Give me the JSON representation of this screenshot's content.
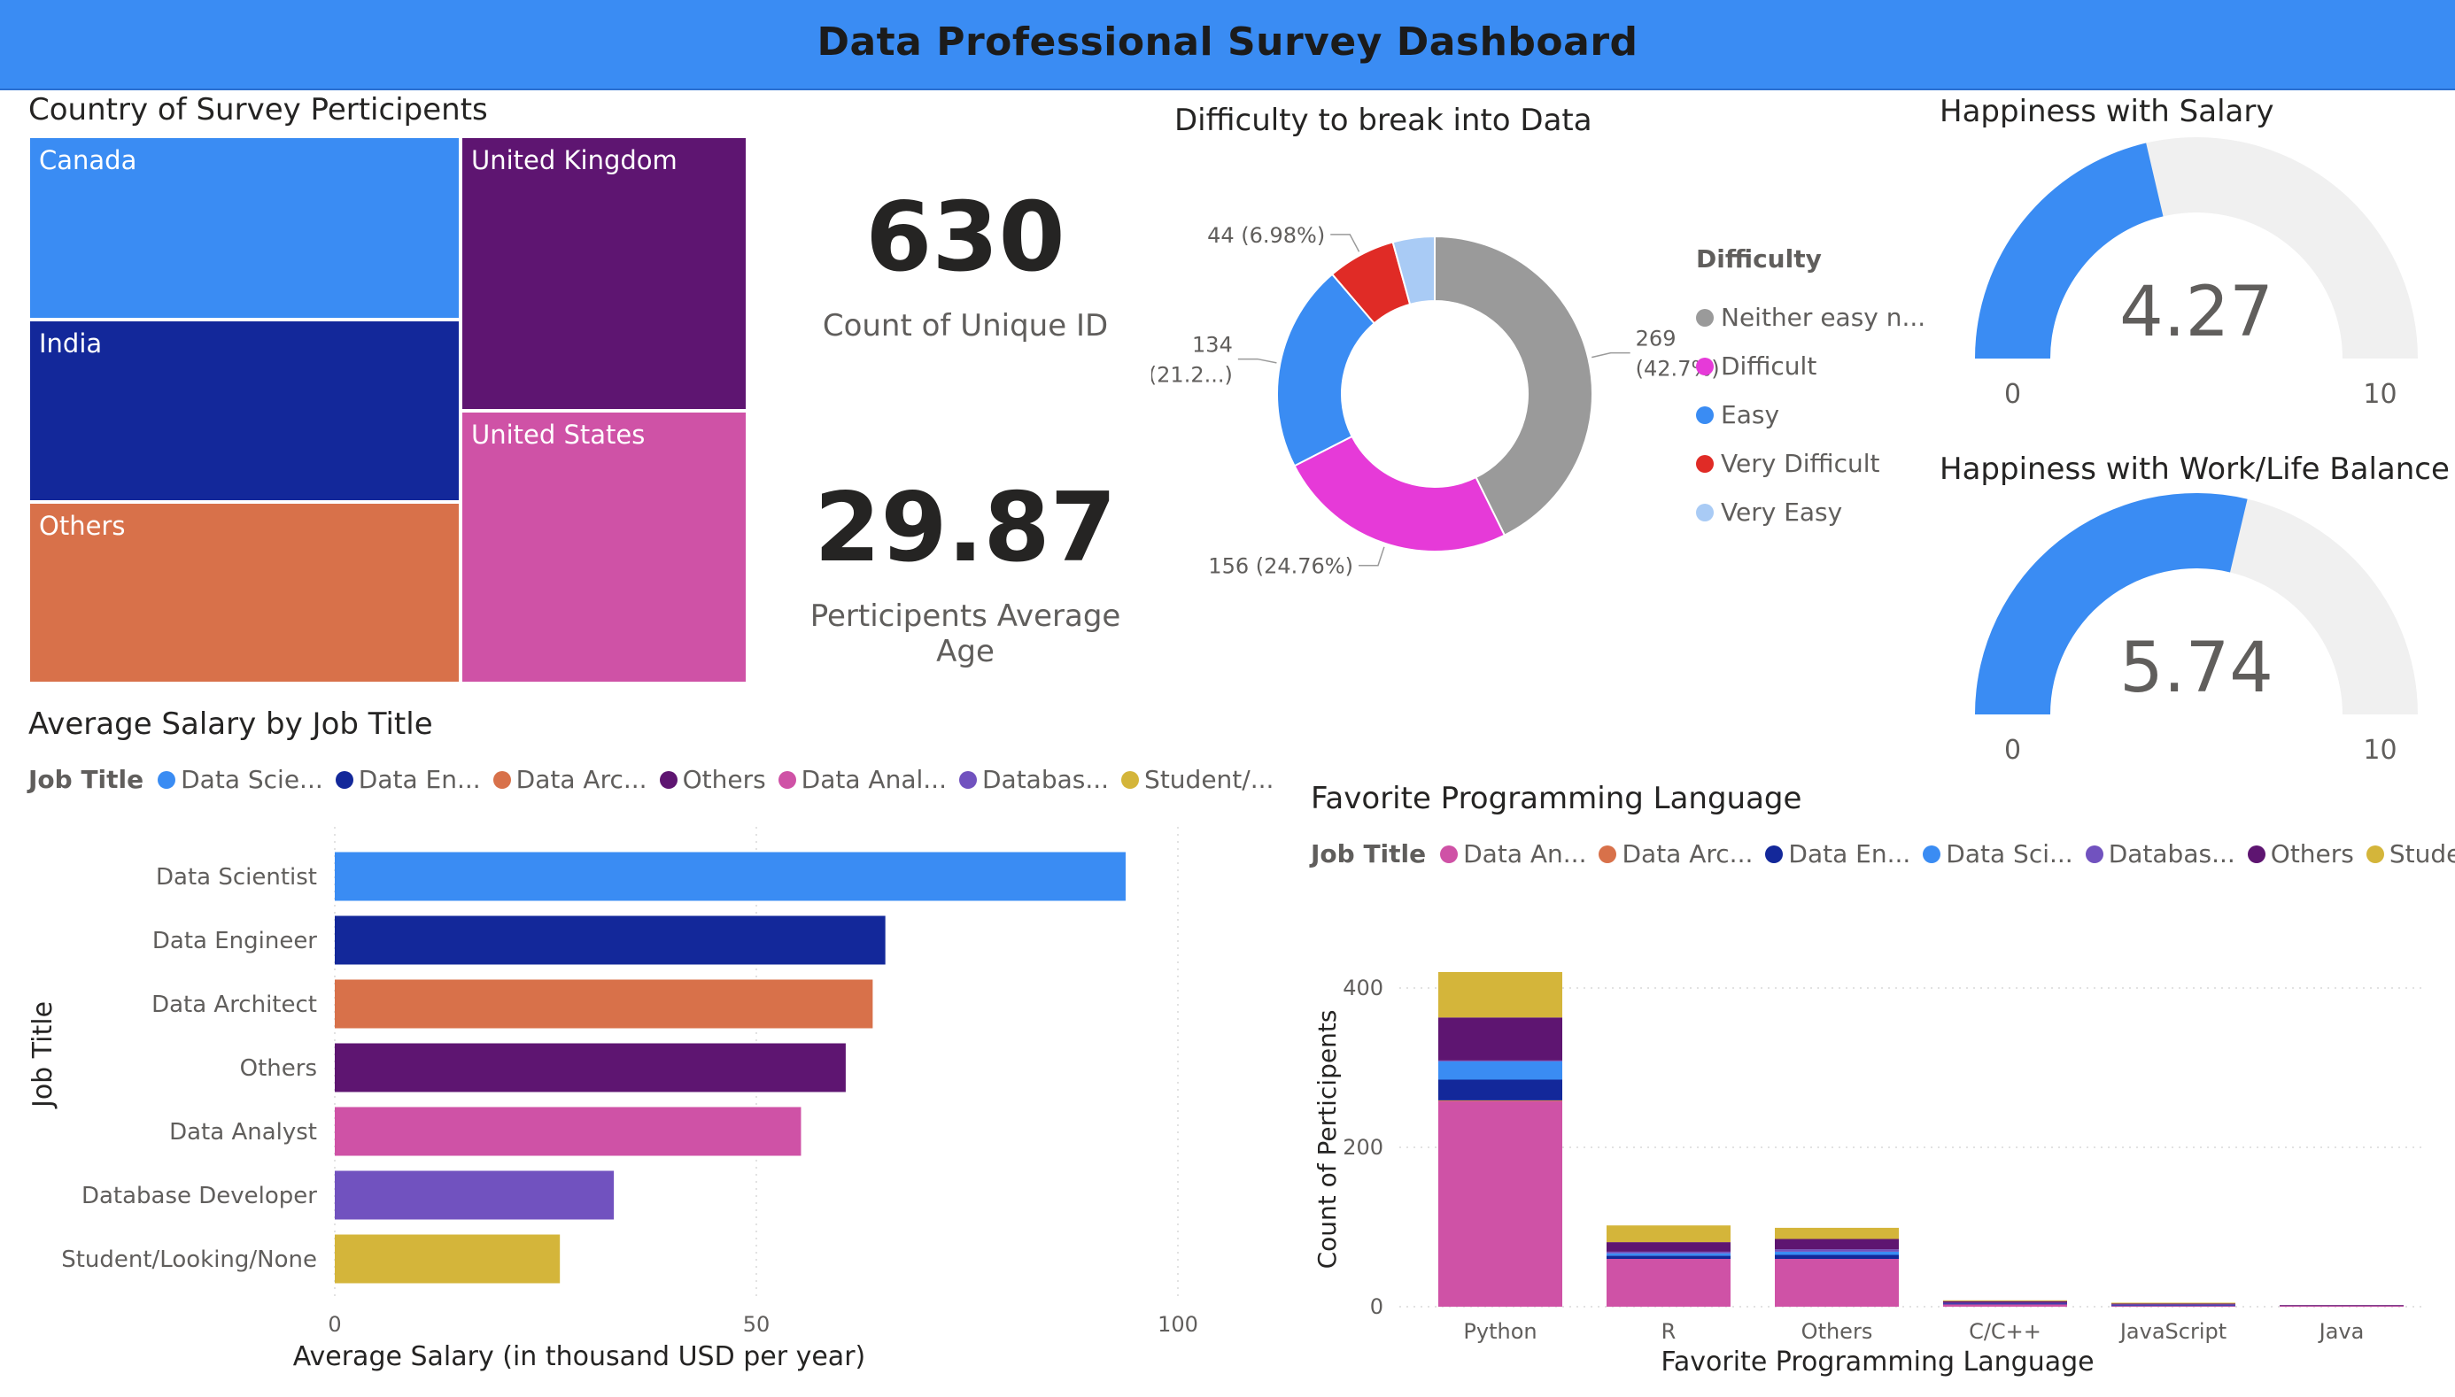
{
  "header": {
    "title": "Data Professional Survey Dashboard"
  },
  "colors": {
    "header_bg": "#3a8cf3",
    "blue": "#3a8cf3",
    "navy": "#13289a",
    "orange": "#d8714a",
    "purple": "#5e1571",
    "pink": "#cf52a6",
    "violet": "#7152bf",
    "gold": "#d4b53a",
    "grey": "#9a9a9a",
    "magenta": "#e63ad8",
    "red": "#e02b26",
    "lightblue": "#a9cbf5"
  },
  "treemap": {
    "title": "Country of Survey Perticipents",
    "cells": [
      {
        "label": "Canada",
        "color": "#3a8cf3"
      },
      {
        "label": "United Kingdom",
        "color": "#5e1571"
      },
      {
        "label": "India",
        "color": "#13289a"
      },
      {
        "label": "United States",
        "color": "#cf52a6"
      },
      {
        "label": "Others",
        "color": "#d8714a"
      }
    ]
  },
  "kpis": [
    {
      "value": "630",
      "label": "Count of Unique ID"
    },
    {
      "value": "29.87",
      "label": "Perticipents Average Age"
    }
  ],
  "gauges": [
    {
      "title": "Happiness with Salary",
      "value": 4.27,
      "value_text": "4.27",
      "min": 0,
      "max": 10,
      "min_text": "0",
      "max_text": "10",
      "fill": "#3a8cf3",
      "track": "#f0f0f0"
    },
    {
      "title": "Happiness with Work/Life Balance",
      "value": 5.74,
      "value_text": "5.74",
      "min": 0,
      "max": 10,
      "min_text": "0",
      "max_text": "10",
      "fill": "#3a8cf3",
      "track": "#f0f0f0"
    }
  ],
  "bar_legend": {
    "title": "Job Title",
    "items": [
      {
        "label": "Data Scie...",
        "color": "#3a8cf3"
      },
      {
        "label": "Data En...",
        "color": "#13289a"
      },
      {
        "label": "Data Arc...",
        "color": "#d8714a"
      },
      {
        "label": "Others",
        "color": "#5e1571"
      },
      {
        "label": "Data Anal...",
        "color": "#cf52a6"
      },
      {
        "label": "Databas...",
        "color": "#7152bf"
      },
      {
        "label": "Student/...",
        "color": "#d4b53a"
      }
    ]
  },
  "col_legend": {
    "title": "Job Title",
    "items": [
      {
        "label": "Data An...",
        "color": "#cf52a6"
      },
      {
        "label": "Data Arc...",
        "color": "#d8714a"
      },
      {
        "label": "Data En...",
        "color": "#13289a"
      },
      {
        "label": "Data Sci...",
        "color": "#3a8cf3"
      },
      {
        "label": "Databas...",
        "color": "#7152bf"
      },
      {
        "label": "Others",
        "color": "#5e1571"
      },
      {
        "label": "Student/...",
        "color": "#d4b53a"
      }
    ]
  },
  "chart_data": [
    {
      "type": "pie",
      "title": "Difficulty to break into Data",
      "legend_title": "Difficulty",
      "legend_items": [
        "Neither easy n...",
        "Difficult",
        "Easy",
        "Very Difficult",
        "Very Easy"
      ],
      "slices": [
        {
          "label": "Neither easy n...",
          "value": 269,
          "color": "#9a9a9a",
          "data_label": [
            "269",
            "(42.7%)"
          ]
        },
        {
          "label": "Difficult",
          "value": 156,
          "color": "#e63ad8",
          "data_label": [
            "156 (24.76%)"
          ]
        },
        {
          "label": "Easy",
          "value": 134,
          "color": "#3a8cf3",
          "data_label": [
            "134",
            "(21.2...)"
          ]
        },
        {
          "label": "Very Difficult",
          "value": 44,
          "color": "#e02b26",
          "data_label": [
            "44 (6.98%)"
          ]
        },
        {
          "label": "Very Easy",
          "value": 27,
          "color": "#a9cbf5",
          "data_label": []
        }
      ]
    },
    {
      "type": "bar",
      "orientation": "horizontal",
      "title": "Average Salary by Job Title",
      "xlabel": "Average Salary (in thousand USD per year)",
      "ylabel": "Job Title",
      "xlim": [
        0,
        100
      ],
      "xticks": [
        0,
        50,
        100
      ],
      "xtick_labels": [
        "0",
        "50",
        "100"
      ],
      "grid": true,
      "categories": [
        "Data Scientist",
        "Data Engineer",
        "Data Architect",
        "Others",
        "Data Analyst",
        "Database Developer",
        "Student/Looking/None"
      ],
      "values": [
        93.8,
        65.3,
        63.8,
        60.6,
        55.3,
        33.1,
        26.7
      ],
      "colors": [
        "#3a8cf3",
        "#13289a",
        "#d8714a",
        "#5e1571",
        "#cf52a6",
        "#7152bf",
        "#d4b53a"
      ]
    },
    {
      "type": "bar",
      "orientation": "vertical",
      "stacked": true,
      "title": "Favorite Programming Language",
      "xlabel": "Favorite Programming Language",
      "ylabel": "Count of Perticipents",
      "ylim": [
        0,
        420
      ],
      "yticks": [
        0,
        200,
        400
      ],
      "ytick_labels": [
        "0",
        "200",
        "400"
      ],
      "grid": true,
      "categories": [
        "Python",
        "R",
        "Others",
        "C/C++",
        "JavaScript",
        "Java"
      ],
      "series": [
        {
          "name": "Data An...",
          "color": "#cf52a6",
          "values": [
            258,
            60,
            60,
            3,
            1,
            1
          ]
        },
        {
          "name": "Data Arc...",
          "color": "#d8714a",
          "values": [
            1,
            0,
            0,
            0,
            0,
            0
          ]
        },
        {
          "name": "Data En...",
          "color": "#13289a",
          "values": [
            26,
            4,
            5,
            1,
            1,
            0
          ]
        },
        {
          "name": "Data Sci...",
          "color": "#3a8cf3",
          "values": [
            23,
            3,
            4,
            0,
            0,
            0
          ]
        },
        {
          "name": "Databas...",
          "color": "#7152bf",
          "values": [
            1,
            2,
            3,
            1,
            1,
            0
          ]
        },
        {
          "name": "Others",
          "color": "#5e1571",
          "values": [
            54,
            12,
            13,
            2,
            1,
            1
          ]
        },
        {
          "name": "Student/...",
          "color": "#d4b53a",
          "values": [
            57,
            21,
            14,
            1,
            1,
            0
          ]
        }
      ]
    }
  ]
}
